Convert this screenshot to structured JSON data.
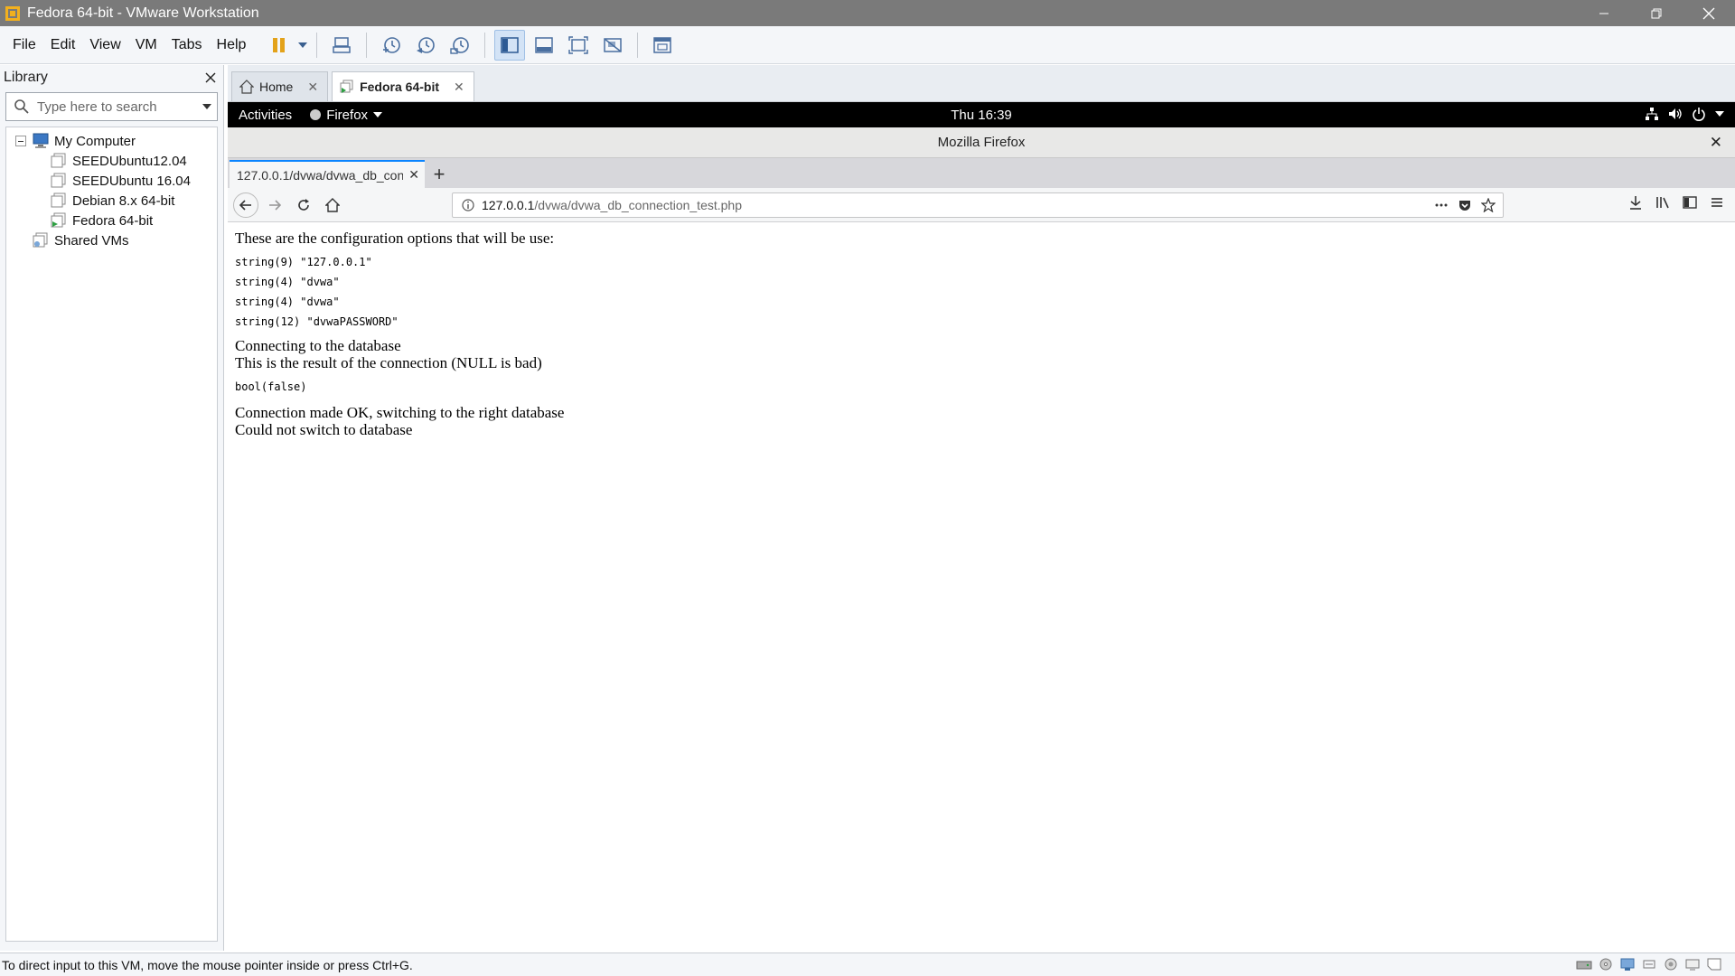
{
  "window": {
    "title": "Fedora 64-bit - VMware Workstation"
  },
  "menu": [
    "File",
    "Edit",
    "View",
    "VM",
    "Tabs",
    "Help"
  ],
  "library": {
    "title": "Library",
    "search_placeholder": "Type here to search",
    "tree": {
      "root": "My Computer",
      "vms": [
        "SEEDUbuntu12.04",
        "SEEDUbuntu 16.04",
        "Debian 8.x 64-bit",
        "Fedora 64-bit"
      ],
      "shared": "Shared VMs"
    }
  },
  "tabs": [
    {
      "label": "Home"
    },
    {
      "label": "Fedora 64-bit"
    }
  ],
  "gnome": {
    "activities": "Activities",
    "app_menu": "Firefox",
    "clock": "Thu 16:39"
  },
  "firefox": {
    "window_title": "Mozilla Firefox",
    "tab_title": "127.0.0.1/dvwa/dvwa_db_conn",
    "url_host": "127.0.0.1",
    "url_path": "/dvwa/dvwa_db_connection_test.php"
  },
  "page": {
    "intro": "These are the configuration options that will be use:",
    "config": [
      "string(9) \"127.0.0.1\"",
      "string(4) \"dvwa\"",
      "string(4) \"dvwa\"",
      "string(12) \"dvwaPASSWORD\""
    ],
    "connecting": "Connecting to the database",
    "result_note": "This is the result of the connection (NULL is bad)",
    "result": "bool(false)",
    "switching": "Connection made OK, switching to the right database",
    "failure": "Could not switch to database"
  },
  "status": {
    "message": "To direct input to this VM, move the mouse pointer inside or press Ctrl+G."
  }
}
